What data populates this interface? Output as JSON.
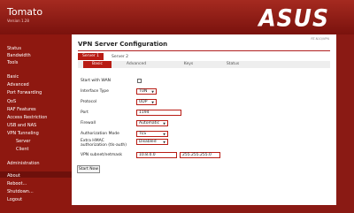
{
  "app": {
    "brand": "Tomato",
    "version": "Version 1.28",
    "logo_text": "ASUS",
    "router_id": "RT-N10/VPN"
  },
  "sidebar": {
    "items": [
      {
        "label": "Status"
      },
      {
        "label": "Bandwidth"
      },
      {
        "label": "Tools"
      },
      {
        "label": "Basic"
      },
      {
        "label": "Advanced"
      },
      {
        "label": "Port Forwarding"
      },
      {
        "label": "QoS"
      },
      {
        "label": "RAF Features"
      },
      {
        "label": "Access Restriction"
      },
      {
        "label": "USB and NAS"
      },
      {
        "label": "VPN Tunneling"
      },
      {
        "label": "Server"
      },
      {
        "label": "Client"
      },
      {
        "label": "Administration"
      },
      {
        "label": "About"
      },
      {
        "label": "Reboot..."
      },
      {
        "label": "Shutdown..."
      },
      {
        "label": "Logout"
      }
    ]
  },
  "page": {
    "title": "VPN Server Configuration",
    "server_tabs": [
      "Server 1",
      "Server 2"
    ],
    "sub_tabs": [
      "Basic",
      "Advanced",
      "Keys",
      "Status"
    ]
  },
  "form": {
    "start_with_wan": {
      "label": "Start with WAN",
      "checked": false
    },
    "interface_type": {
      "label": "Interface Type",
      "value": "TUN"
    },
    "protocol": {
      "label": "Protocol",
      "value": "UDP"
    },
    "port": {
      "label": "Port",
      "value": "1194"
    },
    "firewall": {
      "label": "Firewall",
      "value": "Automatic"
    },
    "auth_mode": {
      "label": "Authorization Mode",
      "value": "TLS"
    },
    "extra_hmac": {
      "label_line1": "Extra HMAC",
      "label_line2": "authorization (tls-auth)",
      "value": "Disabled"
    },
    "vpn_subnet": {
      "label": "VPN subnet/netmask",
      "subnet": "10.8.0.0",
      "netmask": "255.255.255.0"
    }
  },
  "actions": {
    "start_now": "Start Now"
  }
}
